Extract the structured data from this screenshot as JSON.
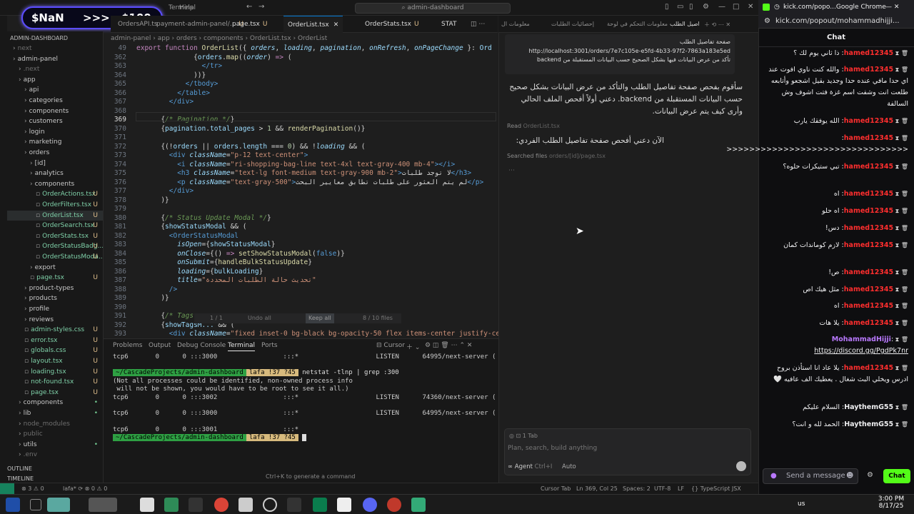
{
  "titlebar": {
    "menus": [
      "File",
      "Edit",
      "Selection",
      "View",
      "Go",
      "Run",
      "Terminal",
      "Help"
    ],
    "search": "admin-dashboard"
  },
  "overlay": {
    "left": "$NaN",
    "mid": ">>>",
    "right": "$100"
  },
  "tabs": [
    "OrdersAPI.ts",
    "payment-admin-panel/...",
    "page.tsx",
    "OrderList.tsx",
    "OrderStats.tsx",
    "STAT"
  ],
  "tabs_u": "U",
  "breadcrumb": "admin-panel › app › orders › components › OrderList.tsx › OrderList",
  "explorer": {
    "header": "ADMIN-DASHBOARD",
    "items": [
      {
        "label": "next",
        "indent": 1,
        "type": "dim"
      },
      {
        "label": "admin-panel",
        "indent": 1,
        "type": "folder"
      },
      {
        "label": ".next",
        "indent": 2,
        "type": "dim"
      },
      {
        "label": "app",
        "indent": 2,
        "type": "folder"
      },
      {
        "label": "api",
        "indent": 3,
        "type": "folder"
      },
      {
        "label": "categories",
        "indent": 3,
        "type": "folder"
      },
      {
        "label": "components",
        "indent": 3,
        "type": "folder"
      },
      {
        "label": "customers",
        "indent": 3,
        "type": "folder"
      },
      {
        "label": "login",
        "indent": 3,
        "type": "folder"
      },
      {
        "label": "marketing",
        "indent": 3,
        "type": "folder"
      },
      {
        "label": "orders",
        "indent": 3,
        "type": "folder"
      },
      {
        "label": "[id]",
        "indent": 4,
        "type": "folder"
      },
      {
        "label": "analytics",
        "indent": 4,
        "type": "folder"
      },
      {
        "label": "components",
        "indent": 4,
        "type": "folder"
      },
      {
        "label": "OrderActions.tsx",
        "indent": 5,
        "type": "file",
        "status": "U"
      },
      {
        "label": "OrderFilters.tsx",
        "indent": 5,
        "type": "file",
        "status": "U"
      },
      {
        "label": "OrderList.tsx",
        "indent": 5,
        "type": "file",
        "status": "U",
        "selected": true
      },
      {
        "label": "OrderSearch.tsx",
        "indent": 5,
        "type": "file",
        "status": "U"
      },
      {
        "label": "OrderStats.tsx",
        "indent": 5,
        "type": "file",
        "status": "U"
      },
      {
        "label": "OrderStatusBadg...",
        "indent": 5,
        "type": "file",
        "status": "U"
      },
      {
        "label": "OrderStatusModa...",
        "indent": 5,
        "type": "file",
        "status": "U"
      },
      {
        "label": "export",
        "indent": 4,
        "type": "folder"
      },
      {
        "label": "page.tsx",
        "indent": 4,
        "type": "file",
        "status": "U"
      },
      {
        "label": "product-types",
        "indent": 3,
        "type": "folder"
      },
      {
        "label": "products",
        "indent": 3,
        "type": "folder"
      },
      {
        "label": "profile",
        "indent": 3,
        "type": "folder"
      },
      {
        "label": "reviews",
        "indent": 3,
        "type": "folder"
      },
      {
        "label": "admin-styles.css",
        "indent": 3,
        "type": "file",
        "status": "U"
      },
      {
        "label": "error.tsx",
        "indent": 3,
        "type": "file",
        "status": "U"
      },
      {
        "label": "globals.css",
        "indent": 3,
        "type": "file",
        "status": "U"
      },
      {
        "label": "layout.tsx",
        "indent": 3,
        "type": "file",
        "status": "U"
      },
      {
        "label": "loading.tsx",
        "indent": 3,
        "type": "file",
        "status": "U"
      },
      {
        "label": "not-found.tsx",
        "indent": 3,
        "type": "file",
        "status": "U"
      },
      {
        "label": "page.tsx",
        "indent": 3,
        "type": "file",
        "status": "U"
      },
      {
        "label": "components",
        "indent": 2,
        "type": "folder",
        "dot": true
      },
      {
        "label": "lib",
        "indent": 2,
        "type": "folder",
        "dot": true
      },
      {
        "label": "node_modules",
        "indent": 2,
        "type": "dim"
      },
      {
        "label": "public",
        "indent": 2,
        "type": "dim"
      },
      {
        "label": "utils",
        "indent": 2,
        "type": "folder",
        "dot": true
      },
      {
        "label": ".env",
        "indent": 2,
        "type": "dim"
      }
    ],
    "outline": "OUTLINE",
    "timeline": "TIMELINE"
  },
  "editor": {
    "lines": [
      {
        "n": "49",
        "html": "<span class='kw'>export function</span> <span class='fn'>OrderList</span>({ <span class='at'>orders</span>, <span class='at'>loading</span>, <span class='at'>pagination</span>, <span class='at'>onRefresh</span>, <span class='at'>onPageChange</span> }: <span class='var'>Ord</span>"
      },
      {
        "n": "362",
        "html": "              {<span class='var'>orders</span>.<span class='fn'>map</span>((<span class='at'>order</span>) <span class='kw'>=&gt;</span> ("
      },
      {
        "n": "363",
        "html": "                <span class='tag'>&lt;/tr&gt;</span>"
      },
      {
        "n": "364",
        "html": "              ))}"
      },
      {
        "n": "365",
        "html": "            <span class='tag'>&lt;/tbody&gt;</span>"
      },
      {
        "n": "366",
        "html": "          <span class='tag'>&lt;/table&gt;</span>"
      },
      {
        "n": "367",
        "html": "        <span class='tag'>&lt;/div&gt;</span>"
      },
      {
        "n": "368",
        "html": ""
      },
      {
        "n": "369",
        "html": "      {<span class='cm'>/* Pagination */</span>}",
        "cur": true
      },
      {
        "n": "370",
        "html": "      {<span class='var'>pagination</span>.<span class='var'>total_pages</span> &gt; <span class='num'>1</span> &amp;&amp; <span class='fn'>renderPagination</span>()}"
      },
      {
        "n": "371",
        "html": ""
      },
      {
        "n": "372",
        "html": "      {(!<span class='var'>orders</span> || <span class='var'>orders</span>.<span class='var'>length</span> === <span class='num'>0</span>) &amp;&amp; !<span class='at'>loading</span> &amp;&amp; ("
      },
      {
        "n": "373",
        "html": "        <span class='tag'>&lt;div</span> <span class='at'>className</span>=<span class='str'>\"p-12 text-center\"</span><span class='tag'>&gt;</span>"
      },
      {
        "n": "374",
        "html": "          <span class='tag'>&lt;i</span> <span class='at'>className</span>=<span class='str'>\"ri-shopping-bag-line text-4xl text-gray-400 mb-4\"</span><span class='tag'>&gt;&lt;/i&gt;</span>"
      },
      {
        "n": "375",
        "html": "          <span class='tag'>&lt;h3</span> <span class='at'>className</span>=<span class='str'>\"text-lg font-medium text-gray-900 mb-2\"</span><span class='tag'>&gt;</span>لا توجد طلبات<span class='tag'>&lt;/h3&gt;</span>"
      },
      {
        "n": "376",
        "html": "          <span class='tag'>&lt;p</span> <span class='at'>className</span>=<span class='str'>\"text-gray-500\"</span><span class='tag'>&gt;</span>لم يتم العثور على طلبات تطابق معايير البحث<span class='tag'>&lt;/p&gt;</span>"
      },
      {
        "n": "377",
        "html": "        <span class='tag'>&lt;/div&gt;</span>"
      },
      {
        "n": "378",
        "html": "      )}"
      },
      {
        "n": "379",
        "html": ""
      },
      {
        "n": "380",
        "html": "      {<span class='cm'>/* Status Update Modal */</span>}"
      },
      {
        "n": "381",
        "html": "      {<span class='var'>showStatusModal</span> &amp;&amp; ("
      },
      {
        "n": "382",
        "html": "        <span class='tag'>&lt;OrderStatusModal</span>"
      },
      {
        "n": "383",
        "html": "          <span class='at'>isOpen</span>={<span class='var'>showStatusModal</span>}"
      },
      {
        "n": "384",
        "html": "          <span class='at'>onClose</span>={() <span class='kw'>=&gt;</span> <span class='fn'>setShowStatusModal</span>(<span class='tag'>false</span>)}"
      },
      {
        "n": "385",
        "html": "          <span class='at'>onSubmit</span>={<span class='fn'>handleBulkStatusUpdate</span>}"
      },
      {
        "n": "386",
        "html": "          <span class='at'>loading</span>={<span class='var'>bulkLoading</span>}"
      },
      {
        "n": "387",
        "html": "          <span class='at'>title</span>=<span class='str'>\"تحديث حالة الطلبات المحددة\"</span>"
      },
      {
        "n": "388",
        "html": "        <span class='tag'>/&gt;</span>"
      },
      {
        "n": "389",
        "html": "      )}"
      },
      {
        "n": "390",
        "html": ""
      },
      {
        "n": "391",
        "html": "      {<span class='cm'>/* Tags ...</span>"
      },
      {
        "n": "392",
        "html": "      {<span class='var'>showTagsM...</span> &amp;&amp; ("
      },
      {
        "n": "393",
        "html": "        <span class='tag'>&lt;div</span> <span class='at'>className</span>=<span class='str'>\"fixed inset-0 bg-black bg-opacity-50 flex items-center justify-cen</span>"
      }
    ],
    "findbar": {
      "nav": "1 / 1",
      "undo": "Undo all",
      "keep": "Keep all",
      "files": "8 / 10 files"
    }
  },
  "panel": {
    "tabs": [
      "Problems",
      "Output",
      "Debug Console",
      "Terminal",
      "Ports"
    ],
    "active": "Terminal",
    "cursor_label": "Cursor",
    "top_line": "tcp6       0      0 :::3000                 :::*                    LISTEN      64995/next-server (",
    "prompt_path": "~/CascadeProjects/admin-dashboard",
    "prompt_git": "lafa !37 ?45",
    "command": "netstat -tlnp | grep :300",
    "out": [
      "(Not all processes could be identified, non-owned process info",
      " will not be shown, you would have to be root to see it all.)",
      "tcp6       0      0 :::3002                 :::*                    LISTEN      74360/next-server (",
      "tcp6       0      0 :::3000                 :::*                    LISTEN      64995/next-server (",
      "tcp6       0      0 :::3001                 :::*"
    ],
    "cmdk": "Ctrl+K to generate a command"
  },
  "agent": {
    "tabs": [
      "اصيل الطلب",
      "معلومات التحكم في لوحة",
      "إحصائيات الطلبات",
      "معلومات ال"
    ],
    "user_msg": [
      "صفحة تفاصيل الطلب",
      "http://localhost:3001/orders/7e7c105e-e5fd-4b33-97f2-7863a183e5ed",
      "تأكد من عرض البيانات فيها بشكل الصحيح حسب البيانات المستقبلة من backend"
    ],
    "reply": "سأقوم بفحص صفحة تفاصيل الطلب والتأكد من عرض البيانات بشكل صحيح حسب البيانات المستقبلة من backend. دعني أولاً أفحص الملف الحالي وأرى كيف يتم عرض البيانات.",
    "read_label": "Read",
    "read_file": "OrderList.tsx",
    "reply2": "الآن دعني أفحص صفحة تفاصيل الطلب الفردي:",
    "searched_label": "Searched files",
    "searched_file": "orders/[id]/page.tsx",
    "input_tab": "1 Tab",
    "placeholder": "Plan, search, build anything",
    "mode": "Agent",
    "mode_key": "Ctrl+I",
    "model": "Auto"
  },
  "status": {
    "left": "⊗ 3  ⚠ 0",
    "warn": "⊗ 0 ⚠ 0",
    "right": [
      "Cursor Tab",
      "Ln 369, Col 25",
      "Spaces: 2",
      "UTF-8",
      "LF",
      "{} TypeScript JSX"
    ]
  },
  "chrome": {
    "title": "kick.com/popo...Google Chrome",
    "url": "kick.com/popout/mohammadhijji...",
    "chat": "Chat",
    "messages": [
      {
        "user": "hamed12345",
        "text": "ذا ثاني يوم لك ؟"
      },
      {
        "user": "hamed12345",
        "text": "والله كنت ناوي افوت عند اي حدا مافي عنده حدا وجديد بقيل اشجعو وأتابعه طلعت انت وشفت اسم غزة فتت اشوف وش السالفة"
      },
      {
        "user": "hamed12345",
        "text": "الله يوفقك يارب"
      },
      {
        "user": "hamed12345",
        "text": "<<<<<<<<<<<<<<<<<<<<<<<<<<<<<<<<"
      },
      {
        "user": "hamed12345",
        "text": "تبي ستيكرات حلوه؟"
      },
      {
        "user": "hamed12345",
        "text": "اه"
      },
      {
        "user": "hamed12345",
        "text": "اه حلو"
      },
      {
        "user": "hamed12345",
        "text": "دس!"
      },
      {
        "user": "hamed12345",
        "text": "لازم كوماندات كمان"
      },
      {
        "user": "hamed12345",
        "text": "ص!"
      },
      {
        "user": "hamed12345",
        "text": "مثل هيك اص"
      },
      {
        "user": "hamed12345",
        "text": "اه"
      },
      {
        "user": "hamed12345",
        "text": "يلا هات"
      },
      {
        "user": "MohammadHijji",
        "text": "https://discord.gg/PgdPk7nr",
        "purple": true
      },
      {
        "user": "hamed12345",
        "text": "يلا عاد انا استأذن بروح ادرس ويخلي البث شغال . يعطيك الف عافيه 🤍"
      },
      {
        "user": "HaythemG55",
        "text": "السلام عليكم",
        "white": true
      },
      {
        "user": "HaythemG55",
        "text": "الحمد لله و انت؟",
        "white": true
      }
    ],
    "send_placeholder": "Send a message",
    "send_btn": "Chat"
  },
  "taskbar": {
    "time": "3:00 PM",
    "date": "8/17/25",
    "lang": "us"
  }
}
